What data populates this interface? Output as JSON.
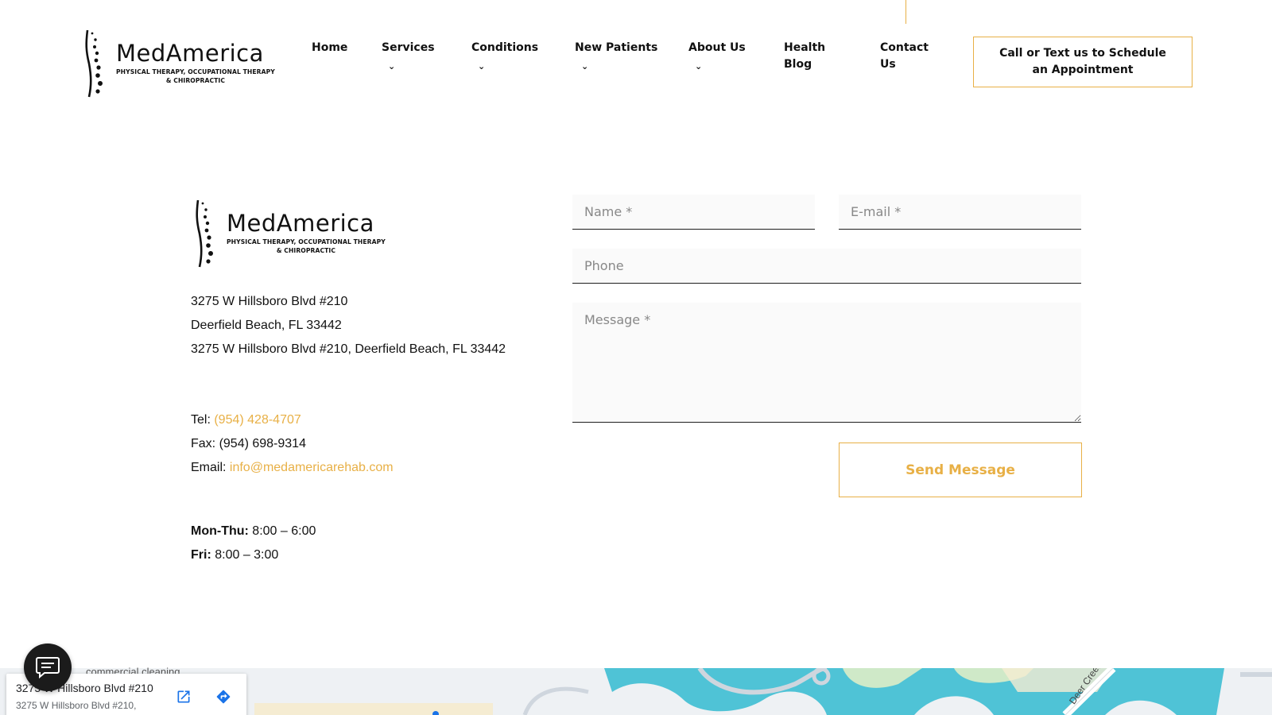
{
  "brand": {
    "name": "MedAmerica",
    "tagline_line1": "PHYSICAL THERAPY, OCCUPATIONAL THERAPY",
    "tagline_line2": "& CHIROPRACTIC"
  },
  "nav": {
    "items": [
      {
        "label": "Home",
        "has_dropdown": false
      },
      {
        "label": "Services",
        "has_dropdown": true
      },
      {
        "label": "Conditions",
        "has_dropdown": true
      },
      {
        "label": "New Patients",
        "has_dropdown": true
      },
      {
        "label": "About Us",
        "has_dropdown": true
      },
      {
        "label": "Health Blog",
        "has_dropdown": false
      },
      {
        "label": "Contact Us",
        "has_dropdown": false
      }
    ],
    "cta_label": "Call or Text us to Schedule an Appointment",
    "chevron": "⌄"
  },
  "contact": {
    "address_line1": "3275 W Hillsboro Blvd #210",
    "address_line2": "Deerfield Beach, FL 33442",
    "address_full": "3275 W Hillsboro Blvd #210, Deerfield Beach, FL 33442",
    "tel_label": "Tel: ",
    "tel": "(954) 428-4707",
    "fax": "Fax: (954) 698-9314",
    "email_label": "Email: ",
    "email": "info@medamericarehab.com",
    "hours": [
      {
        "days": "Mon-Thu:",
        "time": " 8:00 – 6:00"
      },
      {
        "days": "Fri:",
        "time": " 8:00 – 3:00"
      }
    ]
  },
  "form": {
    "name_placeholder": "Name *",
    "email_placeholder": "E-mail *",
    "phone_placeholder": "Phone",
    "message_placeholder": "Message *",
    "submit_label": "Send Message"
  },
  "map": {
    "place_title": "3275 W Hillsboro Blvd #210",
    "place_sub": "3275 W Hillsboro Blvd #210,",
    "poi_label": "commercial cleaning",
    "road_label": "Deer Creek",
    "open_icon": "open-in-new-icon",
    "directions_icon": "directions-icon"
  },
  "colors": {
    "accent": "#e8b046",
    "text": "#111111",
    "field_bg": "#fafafa",
    "chat_bg": "#1b1b1b",
    "map_water": "#4fc3d6",
    "map_park": "#cfe9c8"
  },
  "chat": {
    "icon": "chat-bubble-icon"
  }
}
